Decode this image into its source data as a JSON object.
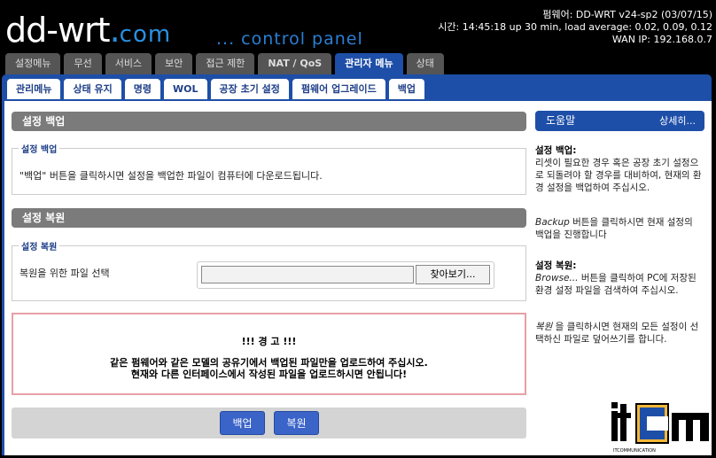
{
  "brand": {
    "logo_main": "dd-wrt",
    "logo_dot": ".",
    "logo_com": "com",
    "tagline": "... control panel"
  },
  "sysinfo": {
    "firmware": "펌웨어: DD-WRT v24-sp2 (03/07/15)",
    "time": "시간: 14:45:18 up 30 min, load average: 0.02, 0.09, 0.12",
    "wan_ip": "WAN IP: 192.168.0.7"
  },
  "tabs": [
    "설정메뉴",
    "무선",
    "서비스",
    "보안",
    "접근 제한",
    "NAT / QoS",
    "관리자 메뉴",
    "상태"
  ],
  "active_tab": "관리자 메뉴",
  "subtabs": [
    "관리메뉴",
    "상태 유지",
    "명령",
    "WOL",
    "공장 초기 설정",
    "펌웨어 업그레이드",
    "백업"
  ],
  "active_subtab": "백업",
  "backup": {
    "header": "설정 백업",
    "legend": "설정 백업",
    "description": "\"백업\" 버튼을 클릭하시면 설정을 백업한 파일이 컴퓨터에 다운로드됩니다."
  },
  "restore": {
    "header": "설정 복원",
    "legend": "설정 복원",
    "file_label": "복원을 위한 파일 선택",
    "browse_label": "찾아보기..."
  },
  "warning": {
    "title": "!!! 경 고 !!!",
    "line1": "같은 펌웨어와 같은 모델의 공유기에서 백업된 파일만을 업로드하여 주십시오.",
    "line2": "현재와 다른 인터페이스에서 작성된 파일을 업로드하시면 안됩니다!"
  },
  "buttons": {
    "backup": "백업",
    "restore": "복원"
  },
  "help": {
    "title": "도움말",
    "more": "상세히...",
    "backup_head": "설정 백업:",
    "backup_text1": "리셋이 필요한 경우 혹은 공장 초기 설정으로 되돌려야 할 경우를 대비하여, 현재의 환경 설정을 백업하여 주십시오.",
    "backup_text2_em": "Backup",
    "backup_text2": " 버튼을 클릭하시면 현재 설정의 백업을 진행합니다",
    "restore_head": "설정 복원:",
    "restore_text1_em": "Browse...",
    "restore_text1": " 버튼을 클릭하여 PC에 저장된 환경 설정 파일을 검색하여 주십시오.",
    "restore_text2_em": "복원",
    "restore_text2": " 을 클릭하시면 현재의 모든 설정이 선택하신 파일로 덮어쓰기를 합니다."
  },
  "watermark": {
    "text": "itcm",
    "sub": "ITCOMMUNICATION"
  },
  "colors": {
    "accent": "#1e4fa8",
    "header_bar": "#7b7b7b",
    "warning_border": "#e8a0a6",
    "button": "#3b64c8"
  }
}
